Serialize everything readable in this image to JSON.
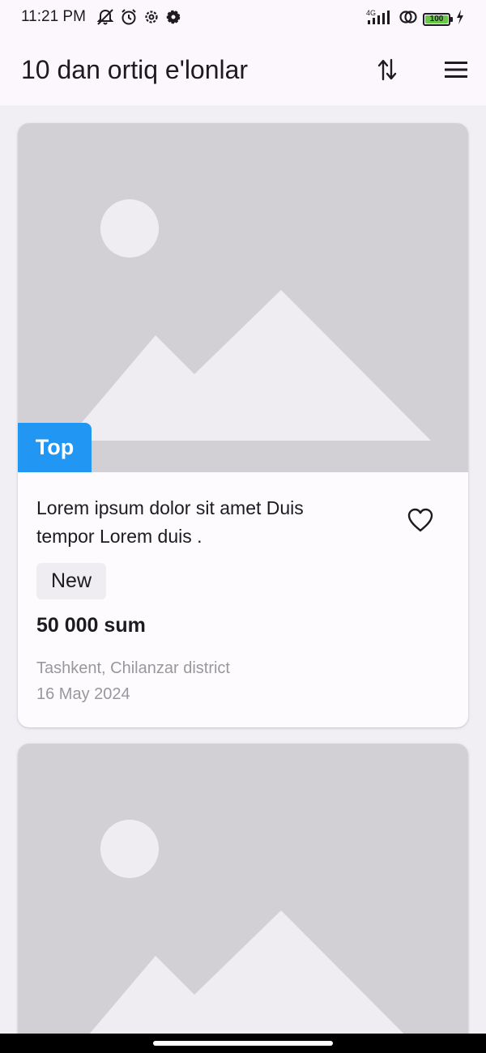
{
  "status_bar": {
    "time": "11:21 PM",
    "left_icons": [
      "bell-off-icon",
      "alarm-icon",
      "settings-outline-icon",
      "settings-icon"
    ],
    "network": "4G",
    "battery_level": "100"
  },
  "app_bar": {
    "title": "10 dan ortiq e'lonlar",
    "actions": [
      "sort-icon",
      "menu-icon"
    ]
  },
  "listings": [
    {
      "image": "image-placeholder",
      "badge": "Top",
      "title": "Lorem ipsum dolor sit amet Duis tempor Lorem duis .",
      "condition": "New",
      "price": "50 000 sum",
      "location": "Tashkent, Chilanzar district",
      "date": "16 May 2024",
      "favorite_icon": "heart-outline-icon"
    },
    {
      "image": "image-placeholder"
    }
  ],
  "colors": {
    "badge_bg": "#2196f3",
    "placeholder_bg": "#d2d0d4",
    "placeholder_shape": "#efedf1",
    "meta_text": "#9a979c"
  }
}
